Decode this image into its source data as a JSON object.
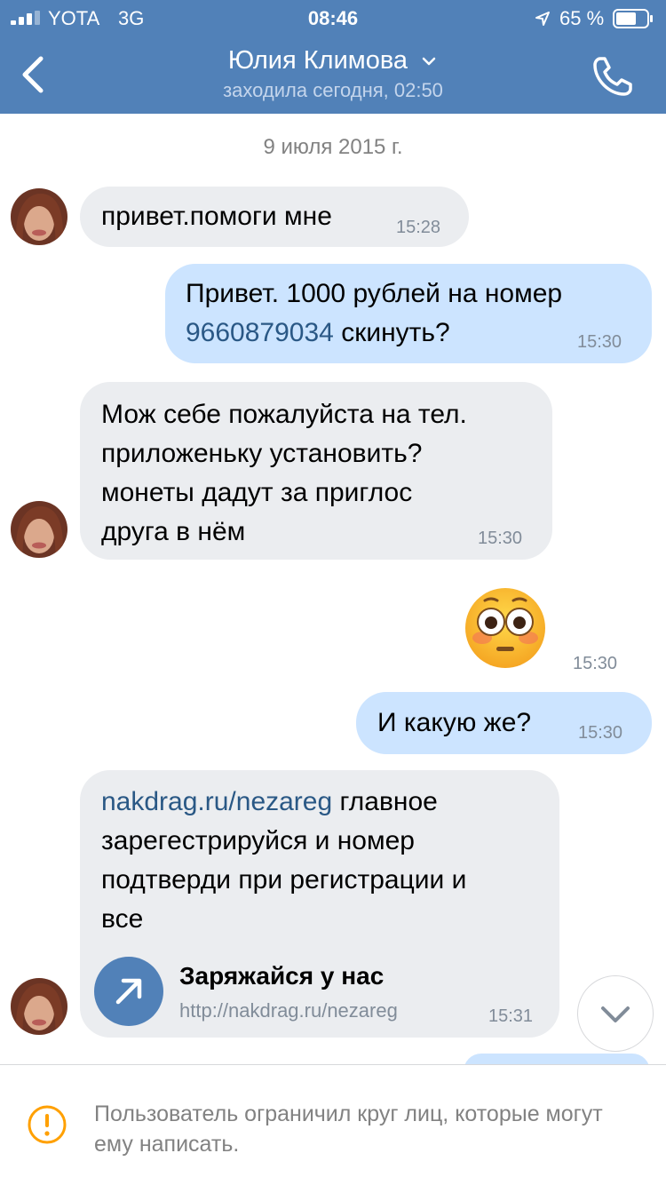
{
  "status_bar": {
    "carrier": "YOTA",
    "network": "3G",
    "time": "08:46",
    "battery": "65 %"
  },
  "header": {
    "contact_name": "Юлия Климова",
    "last_seen": "заходила сегодня, 02:50"
  },
  "chat": {
    "date": "9 июля 2015 г.",
    "messages": [
      {
        "direction": "in",
        "text": "привет.помоги мне",
        "time": "15:28"
      },
      {
        "direction": "out",
        "text_before": "Привет. 1000 рублей на номер",
        "phone": "9660879034",
        "text_after": " скинуть?",
        "time": "15:30"
      },
      {
        "direction": "in",
        "text": "Мож себе пожалуйста на тел.\nприложеньку установить?\nмонеты дадут за приглос\nдруга в нём",
        "time": "15:30"
      },
      {
        "direction": "out",
        "emoji": "flushed-face",
        "time": "15:30"
      },
      {
        "direction": "out",
        "text": "И какую же?",
        "time": "15:30"
      },
      {
        "direction": "in",
        "link_text": "nakdrag.ru/nezareg",
        "text": " главное\nзарегестрируйся и номер\nподтверди при регистрации и\nвсе",
        "card_title": "Заряжайся у нас",
        "card_url": "http://nakdrag.ru/nezareg",
        "time": "15:31"
      }
    ]
  },
  "footer": {
    "restriction_text": "Пользователь ограничил круг лиц, которые могут ему написать."
  },
  "colors": {
    "header_bg": "#5181b8",
    "incoming_bubble": "#ebedf0",
    "outgoing_bubble": "#cce4ff",
    "link": "#2a5885",
    "warning": "#ffa000"
  }
}
